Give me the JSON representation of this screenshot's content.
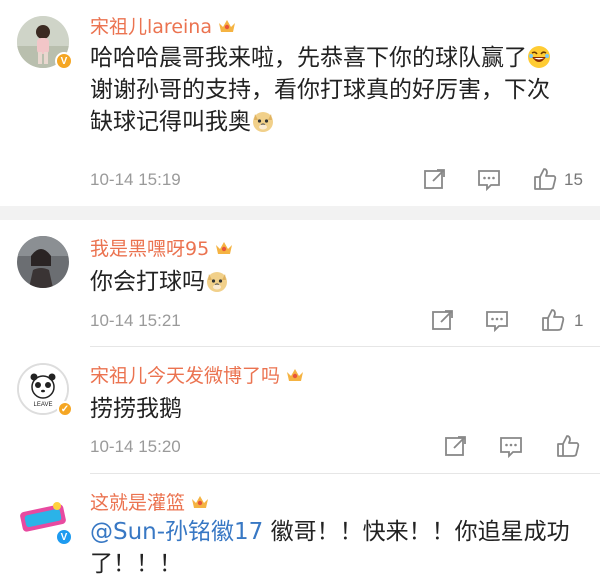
{
  "comments": [
    {
      "name": "宋祖儿lareina",
      "text_before": "哈哈哈晨哥我来啦，先恭喜下你的球队赢了",
      "text_mid": "谢谢孙哥的支持，看你打球真的好厉害，下次缺球记得叫我奥",
      "time": "10-14 15:19",
      "likes": "15",
      "badge": "V",
      "icons": [
        "share-icon",
        "comment-icon",
        "like-icon"
      ]
    },
    {
      "name": "我是黑嘿呀95",
      "text_before": "你会打球吗",
      "time": "10-14 15:21",
      "likes": "1"
    },
    {
      "name": "宋祖儿今天发微博了吗",
      "text_before": "捞捞我鹅",
      "time": "10-14 15:20",
      "likes": "",
      "avatar_text": "LEAVE"
    },
    {
      "name": "这就是灌篮",
      "mention": "@Sun-孙铭徽17",
      "text_after": " 徽哥！！快来！！你追星成功了！！！",
      "badge": "V"
    }
  ],
  "colors": {
    "name": "#eb7350",
    "mention": "#3878c4",
    "meta": "#9a9a9a",
    "divider": "#f2f2f2"
  }
}
